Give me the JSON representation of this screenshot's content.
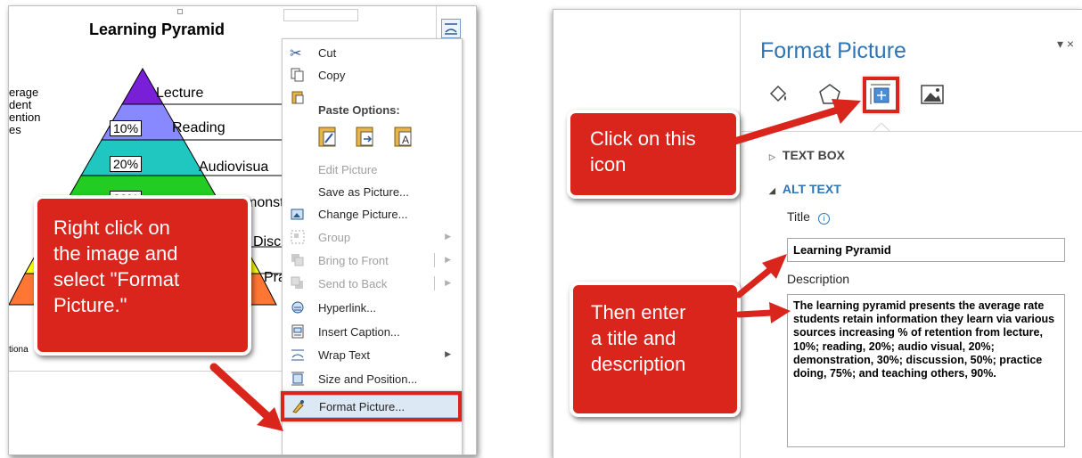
{
  "left": {
    "pyramid": {
      "title": "Learning Pyramid",
      "side_text": [
        "erage",
        "dent",
        "ention",
        "es"
      ],
      "levels": [
        {
          "label": "Lecture",
          "pct": ""
        },
        {
          "label": "Reading",
          "pct": "10%"
        },
        {
          "label": "Audiovisua",
          "pct": "20%"
        },
        {
          "label": "monst",
          "pct": "30%"
        },
        {
          "label": "Discu",
          "pct": ""
        },
        {
          "label": "Pra",
          "pct": ""
        }
      ],
      "bottom_text": "tiona",
      "colors": [
        "#7a1fd8",
        "#8888ff",
        "#1fc7c0",
        "#22cc22",
        "#ffff00",
        "#ff7733"
      ]
    },
    "context_menu": {
      "cut": "Cut",
      "copy": "Copy",
      "paste_options": "Paste Options:",
      "edit_picture": "Edit Picture",
      "save_as_picture": "Save as Picture...",
      "change_picture": "Change Picture...",
      "group": "Group",
      "bring_to_front": "Bring to Front",
      "send_to_back": "Send to Back",
      "hyperlink": "Hyperlink...",
      "insert_caption": "Insert Caption...",
      "wrap_text": "Wrap Text",
      "size_and_position": "Size and Position...",
      "format_picture": "Format Picture..."
    },
    "callout": [
      "Right click on",
      "the image and",
      "select \"Format",
      "Picture.\""
    ]
  },
  "right": {
    "pane_title": "Format Picture",
    "pane_controls": "▾ ×",
    "tabs": [
      "fill-line-icon",
      "effects-icon",
      "layout-properties-icon",
      "picture-icon"
    ],
    "text_box_section": "TEXT BOX",
    "alt_text_section": "ALT TEXT",
    "title_label": "Title",
    "title_value": "Learning Pyramid",
    "description_label": "Description",
    "description_value": "The learning pyramid presents the average rate students retain information they learn via various sources increasing % of retention from lecture, 10%; reading, 20%; audio visual, 20%; demonstration, 30%; discussion, 50%; practice doing, 75%; and teaching others, 90%.",
    "callout_icon": [
      "Click on this",
      "icon"
    ],
    "callout_enter": [
      "Then enter",
      "a title and",
      "description"
    ]
  },
  "accent_color": "#d9251c",
  "link_color": "#2e75b6"
}
